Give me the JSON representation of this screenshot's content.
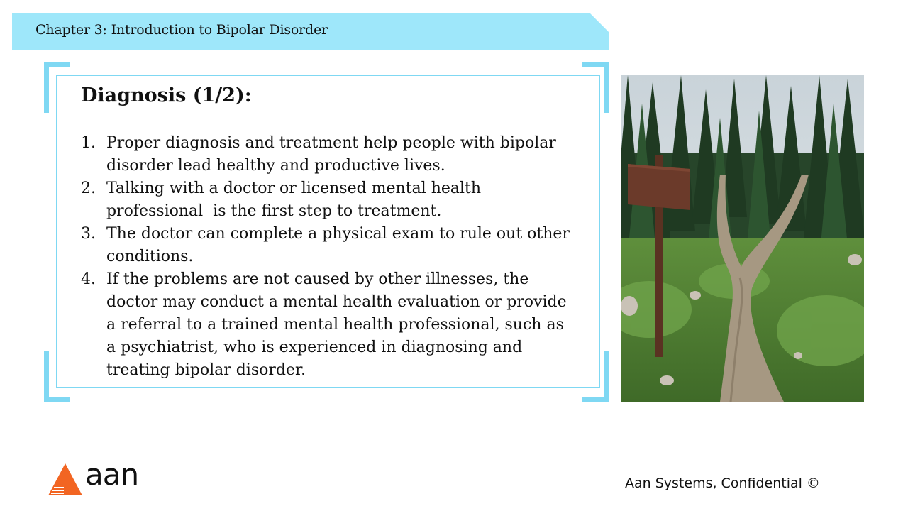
{
  "header": {
    "title": "Chapter 3: Introduction to Bipolar Disorder"
  },
  "content": {
    "title": "Diagnosis (1/2):",
    "items": [
      {
        "number": "1.",
        "lines": [
          "Proper diagnosis and treatment help people with bipolar",
          "disorder lead healthy and productive lives."
        ]
      },
      {
        "number": "2.",
        "lines": [
          "Talking with a doctor or licensed mental health",
          "professional  is the first step to treatment."
        ]
      },
      {
        "number": "3.",
        "lines": [
          "The doctor can complete a physical exam to rule out other",
          "conditions."
        ]
      },
      {
        "number": "4.",
        "lines": [
          "If the problems are not caused by other illnesses, the",
          "doctor may conduct a mental health evaluation or provide",
          "a referral to a trained mental health professional, such as",
          "a psychiatrist, who is experienced in diagnosing and",
          "treating bipolar disorder."
        ]
      }
    ]
  },
  "footer": {
    "logo_text": "aan",
    "confidential": "Aan Systems, Confidential ©"
  },
  "colors": {
    "banner": "#9ee7fa",
    "frame": "#7fd8f3",
    "logo_orange": "#f26522"
  },
  "image": {
    "description_icon": "forest-forked-path-photo"
  }
}
